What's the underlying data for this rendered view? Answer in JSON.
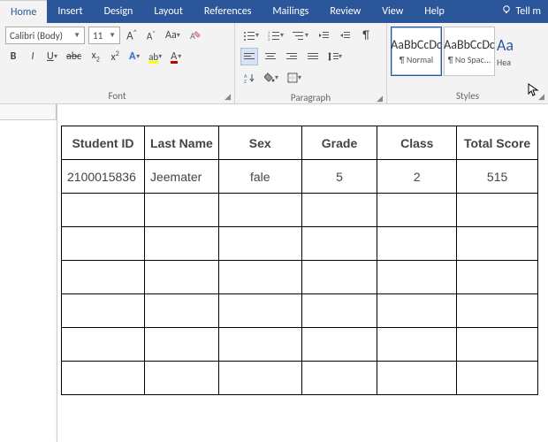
{
  "tabs": {
    "items": [
      "Home",
      "Insert",
      "Design",
      "Layout",
      "References",
      "Mailings",
      "Review",
      "View",
      "Help"
    ],
    "active": 0,
    "tell_me": "Tell m"
  },
  "font": {
    "name": "Calibri (Body)",
    "size": "11",
    "group_label": "Font"
  },
  "paragraph": {
    "group_label": "Paragraph"
  },
  "styles": {
    "group_label": "Styles",
    "items": [
      {
        "preview": "AaBbCcDc",
        "name": "¶ Normal"
      },
      {
        "preview": "AaBbCcDc",
        "name": "¶ No Spac..."
      },
      {
        "preview": "Aa",
        "name": "Hea"
      }
    ]
  },
  "table": {
    "headers": [
      "Student ID",
      "Last Name",
      "Sex",
      "Grade",
      "Class",
      "Total Score"
    ],
    "rows": [
      [
        "2100015836",
        "Jeemater",
        "fale",
        "5",
        "2",
        "515"
      ],
      [
        "",
        "",
        "",
        "",
        "",
        ""
      ],
      [
        "",
        "",
        "",
        "",
        "",
        ""
      ],
      [
        "",
        "",
        "",
        "",
        "",
        ""
      ],
      [
        "",
        "",
        "",
        "",
        "",
        ""
      ],
      [
        "",
        "",
        "",
        "",
        "",
        ""
      ],
      [
        "",
        "",
        "",
        "",
        "",
        ""
      ]
    ]
  }
}
